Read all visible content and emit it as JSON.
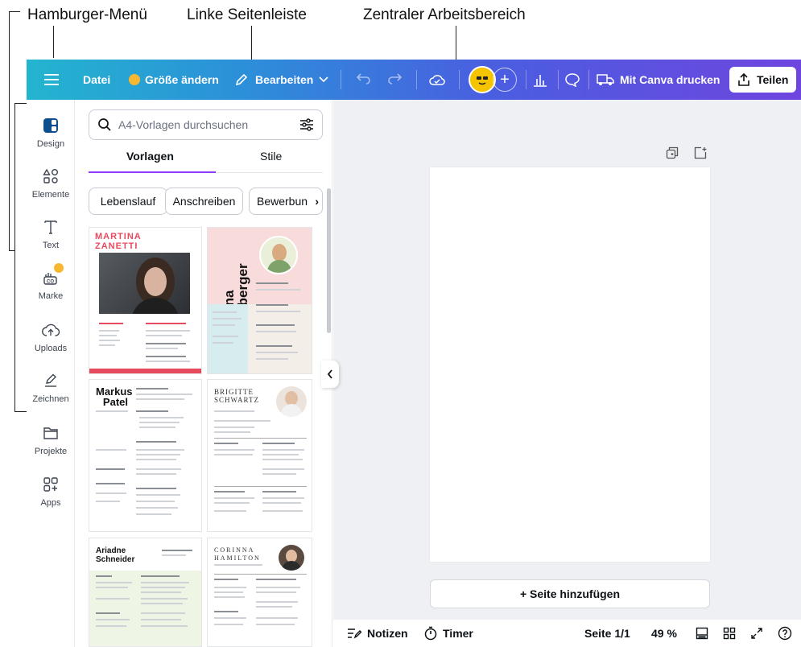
{
  "annotations": {
    "hamburger": "Hamburger-Menü",
    "sidebar": "Linke Seitenleiste",
    "workspace": "Zentraler Arbeitsbereich"
  },
  "topbar": {
    "file": "Datei",
    "resize": "Größe ändern",
    "edit": "Bearbeiten",
    "print": "Mit Canva drucken",
    "share": "Teilen"
  },
  "rail": {
    "items": [
      {
        "label": "Design",
        "icon": "design-icon"
      },
      {
        "label": "Elemente",
        "icon": "elements-icon"
      },
      {
        "label": "Text",
        "icon": "text-icon"
      },
      {
        "label": "Marke",
        "icon": "brand-icon"
      },
      {
        "label": "Uploads",
        "icon": "upload-icon"
      },
      {
        "label": "Zeichnen",
        "icon": "draw-icon"
      },
      {
        "label": "Projekte",
        "icon": "folder-icon"
      },
      {
        "label": "Apps",
        "icon": "apps-icon"
      }
    ]
  },
  "panel": {
    "search_placeholder": "A4-Vorlagen durchsuchen",
    "tabs": [
      "Vorlagen",
      "Stile"
    ],
    "chips": [
      "Lebenslauf",
      "Anschreiben",
      "Bewerbun"
    ]
  },
  "templates": {
    "t1_name": "MARTINA ZANETTI",
    "t2_name": "Anna Auberger",
    "t3_name": "Markus Patel",
    "t4_name": "BRIGITTE SCHWARTZ",
    "t5_name": "Ariadne Schneider",
    "t6_name": "CORINNA HAMILTON"
  },
  "workspace": {
    "add_page": "+ Seite hinzufügen"
  },
  "bottombar": {
    "notes": "Notizen",
    "timer": "Timer",
    "page": "Seite 1/1",
    "zoom": "49 %"
  },
  "colors": {
    "accent": "#8b3dff",
    "topbar_start": "#23b5cf",
    "topbar_end": "#6f45df"
  }
}
